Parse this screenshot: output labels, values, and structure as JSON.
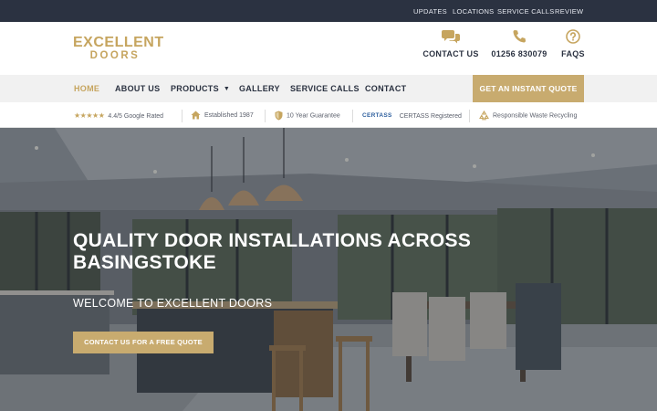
{
  "topbar": {
    "links": [
      "UPDATES",
      "LOCATIONS",
      "SERVICE CALLS",
      "REVIEW"
    ]
  },
  "header": {
    "logo_top": "EXCELLENT",
    "logo_bottom": "DOORS",
    "contact_label": "CONTACT US",
    "phone_label": "01256 830079",
    "faqs_label": "FAQS"
  },
  "nav": {
    "items": [
      "HOME",
      "ABOUT US",
      "PRODUCTS",
      "GALLERY",
      "SERVICE CALLS",
      "CONTACT"
    ],
    "active": "HOME",
    "cta_label": "GET AN INSTANT QUOTE"
  },
  "trust": {
    "rating_text": "4.4/5 Google Rated",
    "rating_value": 4.4,
    "established": "Established 1987",
    "guarantee": "10 Year Guarantee",
    "certass_logo": "CERTASS",
    "certass_text": "CERTASS Registered",
    "recycling": "Responsible Waste Recycling"
  },
  "hero": {
    "title": "QUALITY DOOR INSTALLATIONS ACROSS BASINGSTOKE",
    "subtitle": "WELCOME TO EXCELLENT DOORS",
    "button_label": "CONTACT US FOR A FREE QUOTE"
  },
  "icons": {
    "contact": "chat-bubbles-icon",
    "phone": "phone-icon",
    "faqs": "question-circle-icon",
    "established": "house-icon",
    "guarantee": "shield-icon",
    "recycling": "recycle-icon"
  },
  "colors": {
    "topbar": "#2b3241",
    "gold": "#c8ab6f",
    "nav_bg": "#f1f1f1",
    "text_dark": "#2b3241"
  }
}
